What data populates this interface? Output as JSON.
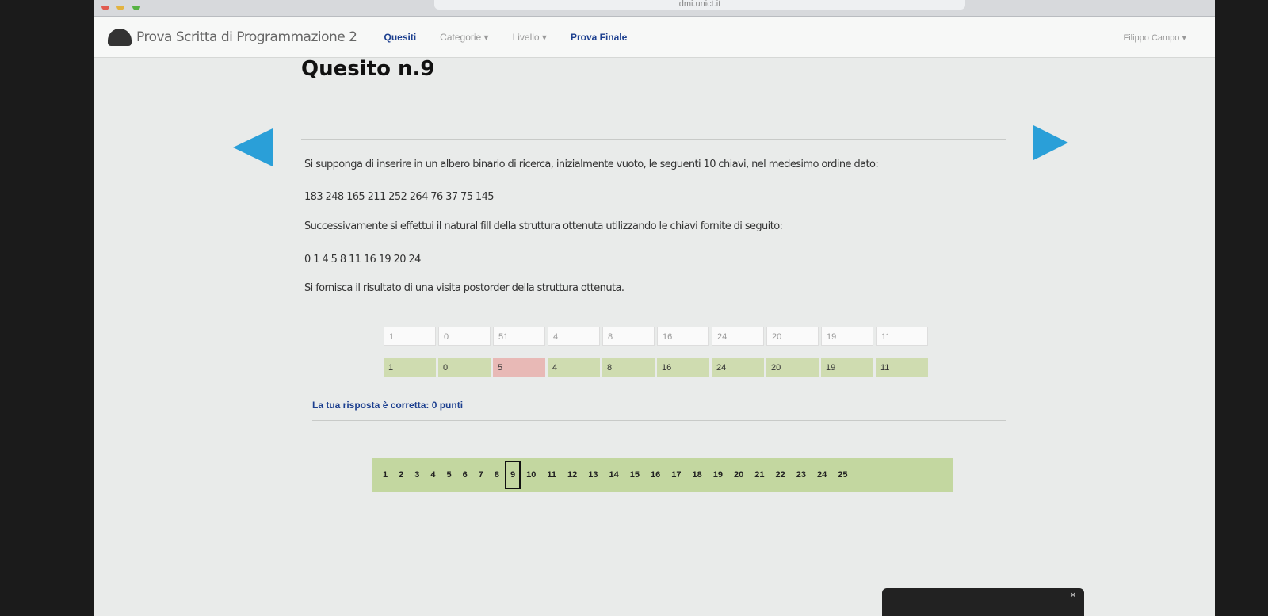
{
  "browser": {
    "url": "dmi.unict.it"
  },
  "navbar": {
    "brand": "Prova Scritta di Programmazione 2",
    "items": [
      {
        "label": "Quesiti",
        "active": true
      },
      {
        "label": "Categorie ▾",
        "active": false
      },
      {
        "label": "Livello ▾",
        "active": false
      },
      {
        "label": "Prova Finale",
        "active": true
      }
    ],
    "user": "Filippo Campo ▾"
  },
  "question": {
    "title": "Quesito n.9",
    "text1": "Si supponga di inserire in un albero binario di ricerca, inizialmente vuoto, le seguenti 10 chiavi, nel medesimo ordine dato:",
    "keys": "183 248 165 211 252 264 76 37 75 145",
    "text2": "Successivamente si effettui il natural fill della struttura ottenuta utilizzando le chiavi fornite di seguito:",
    "fill_keys": "0 1 4 5 8 11 16 19 20 24",
    "text3": "Si fornisca il risultato di una visita postorder della struttura ottenuta."
  },
  "answers": {
    "user": [
      "1",
      "0",
      "51",
      "4",
      "8",
      "16",
      "24",
      "20",
      "19",
      "11"
    ],
    "correct": [
      "1",
      "0",
      "5",
      "4",
      "8",
      "16",
      "24",
      "20",
      "19",
      "11"
    ],
    "wrong_index": 2
  },
  "result": "La tua risposta è corretta: 0 punti",
  "pager": {
    "pages": [
      "1",
      "2",
      "3",
      "4",
      "5",
      "6",
      "7",
      "8",
      "9",
      "10",
      "11",
      "12",
      "13",
      "14",
      "15",
      "16",
      "17",
      "18",
      "19",
      "20",
      "21",
      "22",
      "23",
      "24",
      "25"
    ],
    "current": "9"
  },
  "taskbar": {
    "close": "×"
  },
  "colors": {
    "accent": "#2a9fd8",
    "nav_active": "#1c3f8f",
    "ok": "#cfdcb0",
    "wrong": "#e8b9b6"
  }
}
